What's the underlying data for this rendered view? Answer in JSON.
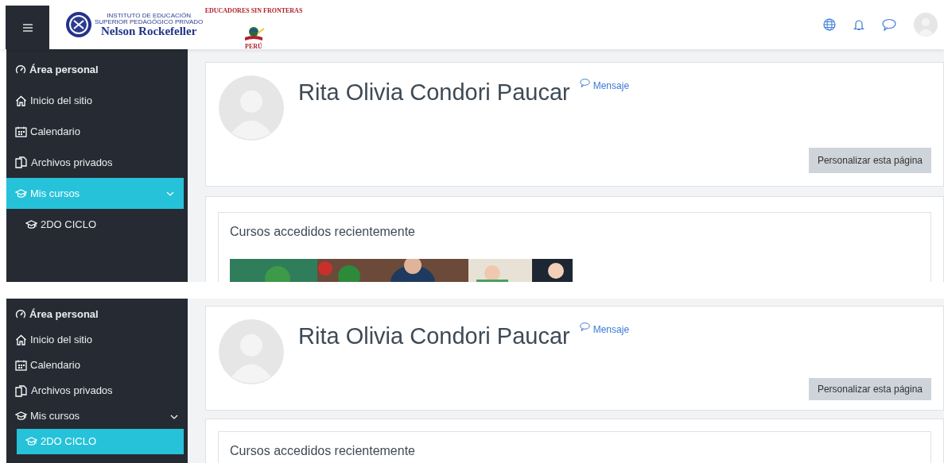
{
  "panels": [
    {
      "navbar": {
        "institution_logo": {
          "lines": [
            "INSTITUTO DE EDUCACIÓN",
            "SUPERIOR PEDAGÓGICO PRIVADO",
            "Nelson Rockefeller"
          ]
        },
        "partner_logo": {
          "arc_text": "EDUCADORES SIN FRONTERAS",
          "country": "PERÚ"
        }
      },
      "sidebar": {
        "items": [
          {
            "label": "Área personal",
            "selected": false
          },
          {
            "label": "Inicio del sitio",
            "selected": false
          },
          {
            "label": "Calendario",
            "selected": false
          },
          {
            "label": "Archivos privados",
            "selected": false
          },
          {
            "label": "Mis cursos",
            "selected": true,
            "expanded": true,
            "children": [
              {
                "label": "2DO CICLO",
                "selected": false
              }
            ]
          }
        ]
      },
      "profile": {
        "name": "Rita Olivia Condori Paucar",
        "message_link": "Mensaje",
        "button": "Personalizar esta página"
      },
      "recent_courses": {
        "title": "Cursos accedidos recientemente"
      }
    },
    {
      "sidebar": {
        "items": [
          {
            "label": "Área personal",
            "selected": false
          },
          {
            "label": "Inicio del sitio",
            "selected": false
          },
          {
            "label": "Calendario",
            "selected": false
          },
          {
            "label": "Archivos privados",
            "selected": false
          },
          {
            "label": "Mis cursos",
            "selected": false,
            "expanded": true,
            "children": [
              {
                "label": "2DO CICLO",
                "selected": true
              }
            ]
          }
        ]
      },
      "profile": {
        "name": "Rita Olivia Condori Paucar",
        "message_link": "Mensaje",
        "button": "Personalizar esta página"
      },
      "recent_courses": {
        "title": "Cursos accedidos recientemente"
      }
    }
  ]
}
